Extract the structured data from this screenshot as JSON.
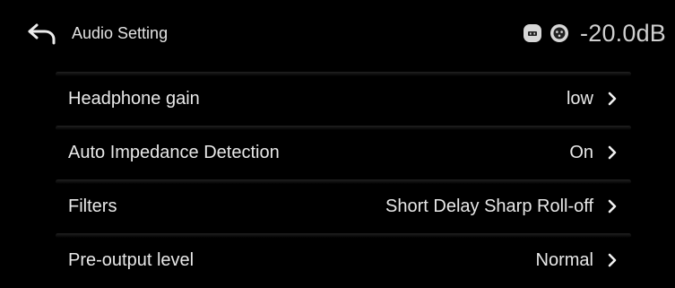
{
  "header": {
    "title": "Audio Setting",
    "volume": "-20.0dB",
    "icons": [
      "back-arrow-icon",
      "output-device-icon",
      "headphone-jack-icon"
    ]
  },
  "settings": [
    {
      "label": "Headphone gain",
      "value": "low"
    },
    {
      "label": "Auto Impedance Detection",
      "value": "On"
    },
    {
      "label": "Filters",
      "value": "Short Delay Sharp Roll-off"
    },
    {
      "label": "Pre-output level",
      "value": "Normal"
    }
  ],
  "colors": {
    "background": "#000000",
    "text": "#e8e8e8",
    "separator": "#3a3a3a"
  }
}
